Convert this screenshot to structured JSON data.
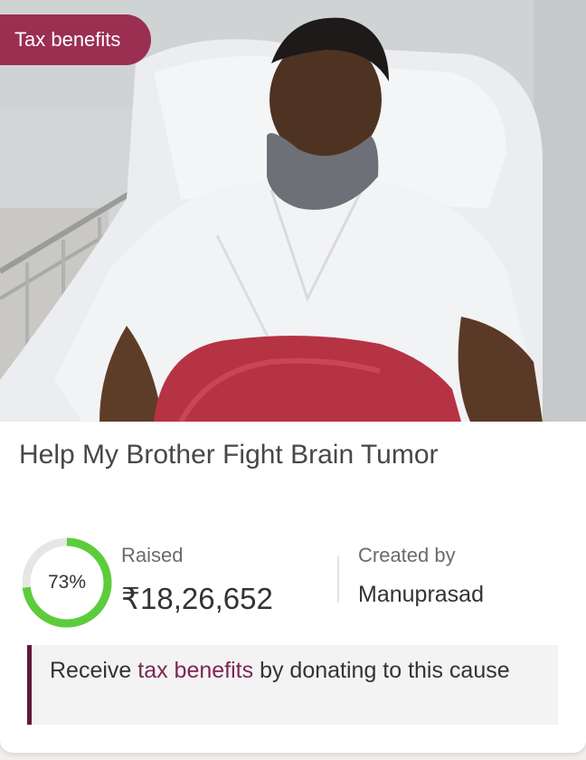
{
  "badge": {
    "label": "Tax benefits"
  },
  "campaign": {
    "title": "Help My Brother Fight Brain Tumor"
  },
  "progress": {
    "percent_label": "73%",
    "fraction": 0.73
  },
  "raised": {
    "label": "Raised",
    "amount": "₹18,26,652"
  },
  "creator": {
    "label": "Created by",
    "name": "Manuprasad"
  },
  "tax_notice": {
    "prefix": "Receive ",
    "link": "tax benefits",
    "suffix": " by donating to this cause"
  },
  "colors": {
    "badge": "#9a2f52",
    "progress_ring": "#5ccc3c",
    "progress_track": "#e6e6e6",
    "notice_accent": "#5d1b3b",
    "link": "#7b2755"
  }
}
